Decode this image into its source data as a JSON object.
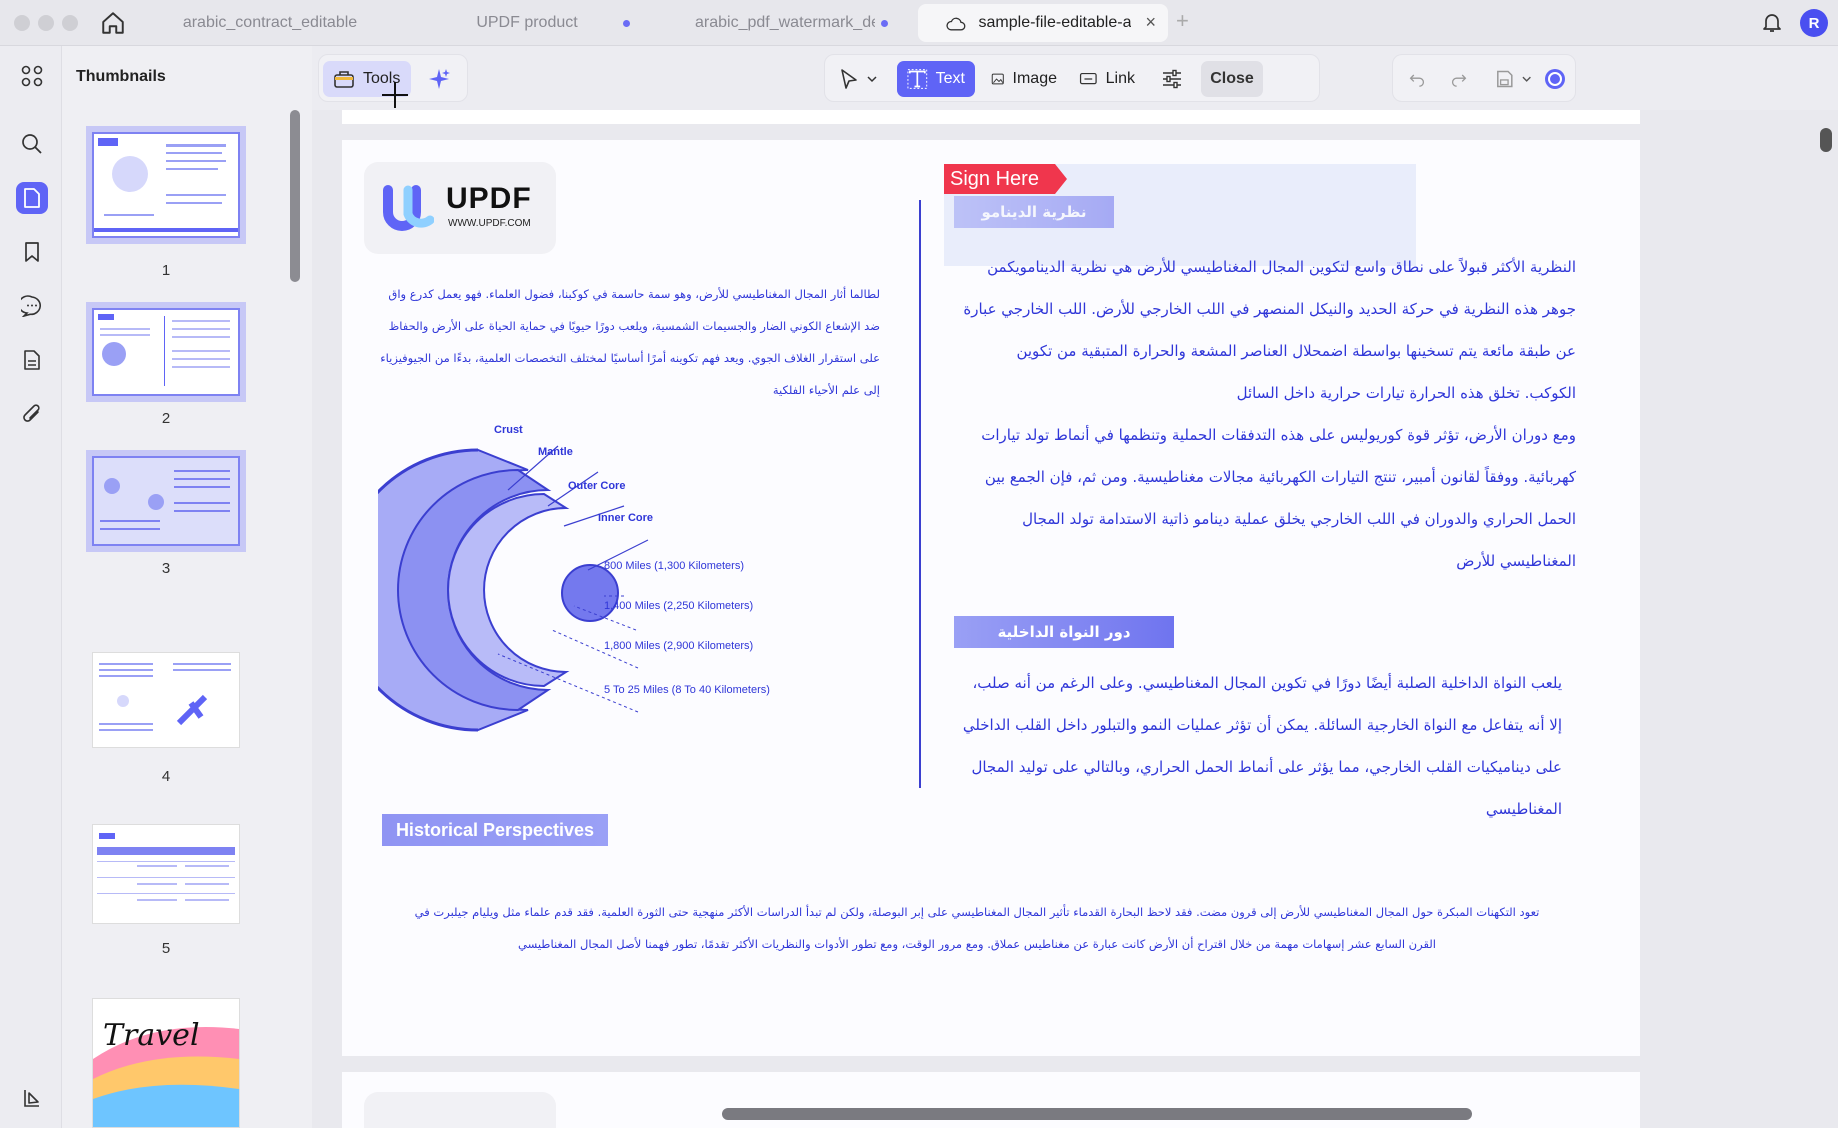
{
  "tabs": [
    {
      "label": "arabic_contract_editable",
      "modified": false
    },
    {
      "label": "UPDF product",
      "modified": true
    },
    {
      "label": "arabic_pdf_watermark_de",
      "modified": true
    },
    {
      "label": "sample-file-editable-a",
      "modified": false,
      "active": true
    }
  ],
  "user": {
    "initial": "R"
  },
  "sidebar": {
    "title": "Thumbnails",
    "pages": [
      "1",
      "2",
      "3",
      "4",
      "5"
    ]
  },
  "toolbar": {
    "tools_label": "Tools",
    "text_label": "Text",
    "image_label": "Image",
    "link_label": "Link",
    "close_label": "Close"
  },
  "document": {
    "logo_word": "UPDF",
    "logo_url": "WWW.UPDF.COM",
    "left_para": "لطالما أثار المجال المغناطيسي للأرض، وهو سمة حاسمة في كوكبنا، فضول العلماء. فهو يعمل كدرع واق ضد الإشعاع الكوني الضار والجسيمات الشمسية، ويلعب دورًا حيويًا في حماية الحياة على الأرض والحفاظ على استقرار الغلاف الجوي. ويعد فهم تكوينه أمرًا أساسيًا لمختلف التخصصات العلمية، بدءًا من الجيوفيزياء إلى علم الأحياء الفلكية",
    "sign_label": "Sign Here",
    "heading1": "نظرية الدينامو",
    "right_para1": "النظرية الأكثر قبولاً على نطاق واسع لتكوين المجال المغناطيسي للأرض هي نظرية الدينامويكمن جوهر هذه النظرية في حركة الحديد والنيكل المنصهر في اللب الخارجي للأرض. اللب الخارجي عبارة عن طبقة مائعة يتم تسخينها بواسطة اضمحلال العناصر المشعة والحرارة المتبقية من تكوين الكوكب. تخلق هذه الحرارة تيارات حرارية داخل السائل",
    "right_para2": "ومع دوران الأرض، تؤثر قوة كوريوليس على هذه التدفقات الحملية وتنظمها في أنماط تولد تيارات كهربائية. ووفقاً لقانون أمبير، تنتج التيارات الكهربائية مجالات مغناطيسية. ومن ثم، فإن الجمع بين الحمل الحراري والدوران في اللب الخارجي يخلق عملية دينامو ذاتية الاستدامة تولد المجال المغناطيسي للأرض",
    "heading2": "دور النواة الداخلية",
    "right_para3": "يلعب النواة الداخلية الصلبة أيضًا دورًا في تكوين المجال المغناطيسي. وعلى الرغم من أنه صلب، إلا أنه يتفاعل مع النواة الخارجية السائلة. يمكن أن تؤثر عمليات النمو والتبلور داخل القلب الداخلي على ديناميكيات القلب الخارجي، مما يؤثر على أنماط الحمل الحراري، وبالتالي على توليد المجال المغناطيسي",
    "hist_heading": "Historical Perspectives",
    "bottom_para": "تعود التكهنات المبكرة حول المجال المغناطيسي للأرض إلى قرون مضت. فقد لاحظ البحارة القدماء تأثير المجال المغناطيسي على إبر البوصلة، ولكن لم تبدأ الدراسات الأكثر منهجية حتى الثورة العلمية. فقد قدم علماء مثل ويليام جيلبرت في القرن السابع عشر إسهامات مهمة من خلال اقتراح أن الأرض كانت عبارة عن مغناطيس عملاق. ومع مرور الوقت، ومع تطور الأدوات والنظريات الأكثر تقدمًا، تطور فهمنا لأصل المجال المغناطيسي",
    "earth_labels": {
      "crust": "Crust",
      "mantle": "Mantle",
      "outer_core": "Outer Core",
      "inner_core": "Inner Core"
    },
    "earth_measures": [
      "800 Miles (1,300 Kilometers)",
      "1,400 Miles (2,250 Kilometers)",
      "1,800 Miles (2,900 Kilometers)",
      "5 To 25 Miles (8 To 40 Kilometers)"
    ]
  },
  "colors": {
    "accent": "#5f64f6",
    "doc_text": "#2f36d8",
    "sign": "#f0364d"
  }
}
